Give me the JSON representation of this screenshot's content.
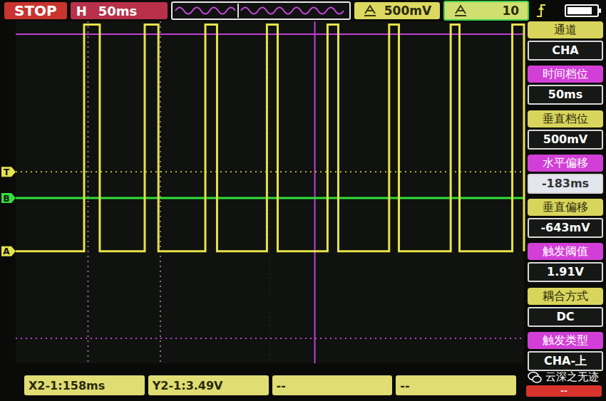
{
  "status_bar": {
    "run_state": "STOP",
    "timebase_label": "H",
    "timebase": "50ms",
    "volts_per_div": "500mV",
    "probe": "10",
    "battery": {
      "level": 0.85
    }
  },
  "chart": {
    "time_ms": [
      0,
      520
    ],
    "volts": [
      -0.286,
      3.637
    ],
    "series": [
      {
        "name": "CHA",
        "color": "#e6e24a",
        "points": [
          [
            0,
            1.0
          ],
          [
            70,
            1.0
          ],
          [
            70,
            3.6
          ],
          [
            86,
            3.6
          ],
          [
            86,
            1.0
          ],
          [
            132,
            1.0
          ],
          [
            132,
            3.6
          ],
          [
            146,
            3.6
          ],
          [
            146,
            1.0
          ],
          [
            194,
            1.0
          ],
          [
            194,
            3.6
          ],
          [
            206,
            3.6
          ],
          [
            206,
            1.0
          ],
          [
            257,
            1.0
          ],
          [
            257,
            3.6
          ],
          [
            268,
            3.6
          ],
          [
            268,
            1.0
          ],
          [
            319,
            1.0
          ],
          [
            319,
            3.6
          ],
          [
            330,
            3.6
          ],
          [
            330,
            1.0
          ],
          [
            382,
            1.0
          ],
          [
            382,
            3.6
          ],
          [
            392,
            3.6
          ],
          [
            392,
            1.0
          ],
          [
            445,
            1.0
          ],
          [
            445,
            3.6
          ],
          [
            454,
            3.6
          ],
          [
            454,
            1.0
          ],
          [
            508,
            1.0
          ],
          [
            508,
            3.6
          ],
          [
            520,
            3.6
          ],
          [
            520,
            1.0
          ]
        ]
      }
    ],
    "markers": [
      {
        "label": "T",
        "volts": 1.91,
        "color": "#e6e24a",
        "line": "dotted"
      },
      {
        "label": "B",
        "volts": 1.61,
        "color": "#33e03a",
        "line": "solid"
      },
      {
        "label": "A",
        "volts": 1.0,
        "color": "#e6e24a",
        "line": "none"
      }
    ],
    "cursors": {
      "vertical_ms": [
        {
          "ms": 74,
          "style": "dotted"
        },
        {
          "ms": 148,
          "style": "dotted"
        },
        {
          "ms": 306,
          "style": "solid"
        }
      ],
      "horizontal_v": [
        {
          "volts": 3.49,
          "style": "solid"
        },
        {
          "volts": 0,
          "style": "dotted"
        }
      ]
    }
  },
  "menu": [
    {
      "label": "通道",
      "value": "CHA",
      "selected": false,
      "color": "#d9d55c"
    },
    {
      "label": "时间档位",
      "value": "50ms",
      "selected": false,
      "color": "#d23fd6"
    },
    {
      "label": "垂直档位",
      "value": "500mV",
      "selected": false,
      "color": "#d9d55c"
    },
    {
      "label": "水平偏移",
      "value": "-183ms",
      "selected": true,
      "color": "#d23fd6"
    },
    {
      "label": "垂直偏移",
      "value": "-643mV",
      "selected": false,
      "color": "#d9d55c"
    },
    {
      "label": "触发阈值",
      "value": "1.91V",
      "selected": false,
      "color": "#d23fd6"
    },
    {
      "label": "耦合方式",
      "value": "DC",
      "selected": false,
      "color": "#d9d55c"
    },
    {
      "label": "触发类型",
      "value": "CHA-上",
      "selected": false,
      "color": "#d23fd6"
    }
  ],
  "readouts": [
    {
      "text": "X2-1:158ms",
      "kind": "normal"
    },
    {
      "text": "Y2-1:3.49V",
      "kind": "normal"
    },
    {
      "text": "--",
      "kind": "normal"
    },
    {
      "text": "--",
      "kind": "normal"
    },
    {
      "text": "--",
      "kind": "alert"
    }
  ],
  "watermark": {
    "text": "云深之无迹"
  }
}
